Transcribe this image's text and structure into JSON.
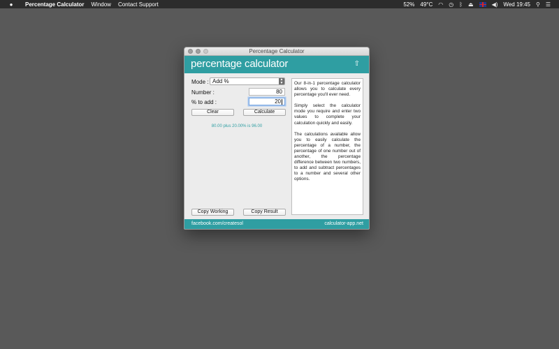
{
  "menubar": {
    "apple_icon": "apple-icon",
    "app_name": "Percentage Calculator",
    "menus": [
      "Window",
      "Contact Support"
    ],
    "battery": "52%",
    "temperature": "49°C",
    "time": "Wed 19:45"
  },
  "window": {
    "title": "Percentage Calculator",
    "brand": "percentage calculator",
    "accent_color": "#2f9ea2"
  },
  "form": {
    "mode_label": "Mode :",
    "mode_value": "Add %",
    "number_label": "Number :",
    "number_value": "80",
    "percent_label": "% to add :",
    "percent_value": "20",
    "clear_label": "Clear",
    "calculate_label": "Calculate",
    "result_text": "80.00 plus 20.00% is 96.00",
    "copy_working_label": "Copy Working",
    "copy_result_label": "Copy Result"
  },
  "description": {
    "p1": "Our 8-in-1 percentage calculator allows you to calculate every percentage you'll ever need.",
    "p2": "Simply select the calculator mode you require and enter two values to complete your calculation quickly and easily.",
    "p3": "The calculations available allow you to easily calculate the percentage of a number, the percentage of one number out of another, the percentage difference between two numbers, to add and subtract percentages to a number and several other options."
  },
  "footer": {
    "left_link": "facebook.com/createsol",
    "right_link": "calculator-app.net"
  }
}
